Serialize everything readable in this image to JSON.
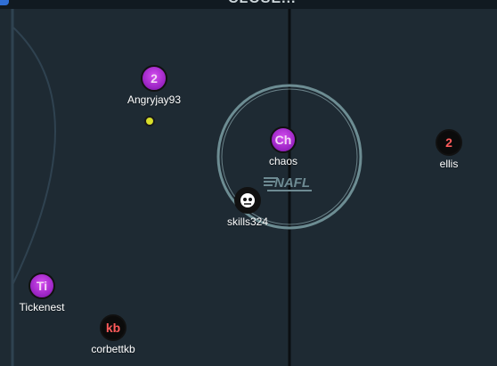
{
  "header": {
    "title_partial": "CLOSE..."
  },
  "players": [
    {
      "initials": "2",
      "name": "Angryjay93",
      "style": "purple"
    },
    {
      "initials": "Ch",
      "name": "chaos",
      "style": "purple"
    },
    {
      "initials": "2",
      "name": "ellis",
      "style": "black"
    },
    {
      "initials": "",
      "name": "skills324",
      "style": "avatar"
    },
    {
      "initials": "Ti",
      "name": "Tickenest",
      "style": "purple"
    },
    {
      "initials": "kb",
      "name": "corbettkb",
      "style": "black"
    }
  ],
  "field": {
    "logo_text": "NAFL"
  },
  "colors": {
    "pitch": "#1e2a33",
    "lines": "#2d3d47",
    "center_line": "#0b0f12",
    "center_circle": "#8fb3b8",
    "purple_token": "#b335d9",
    "black_token": "#0b0b0b",
    "red_text": "#ff5b5b",
    "ball": "#d8de2a"
  },
  "icons": {
    "ball": "ball-icon",
    "avatar": "skull-avatar-icon"
  }
}
